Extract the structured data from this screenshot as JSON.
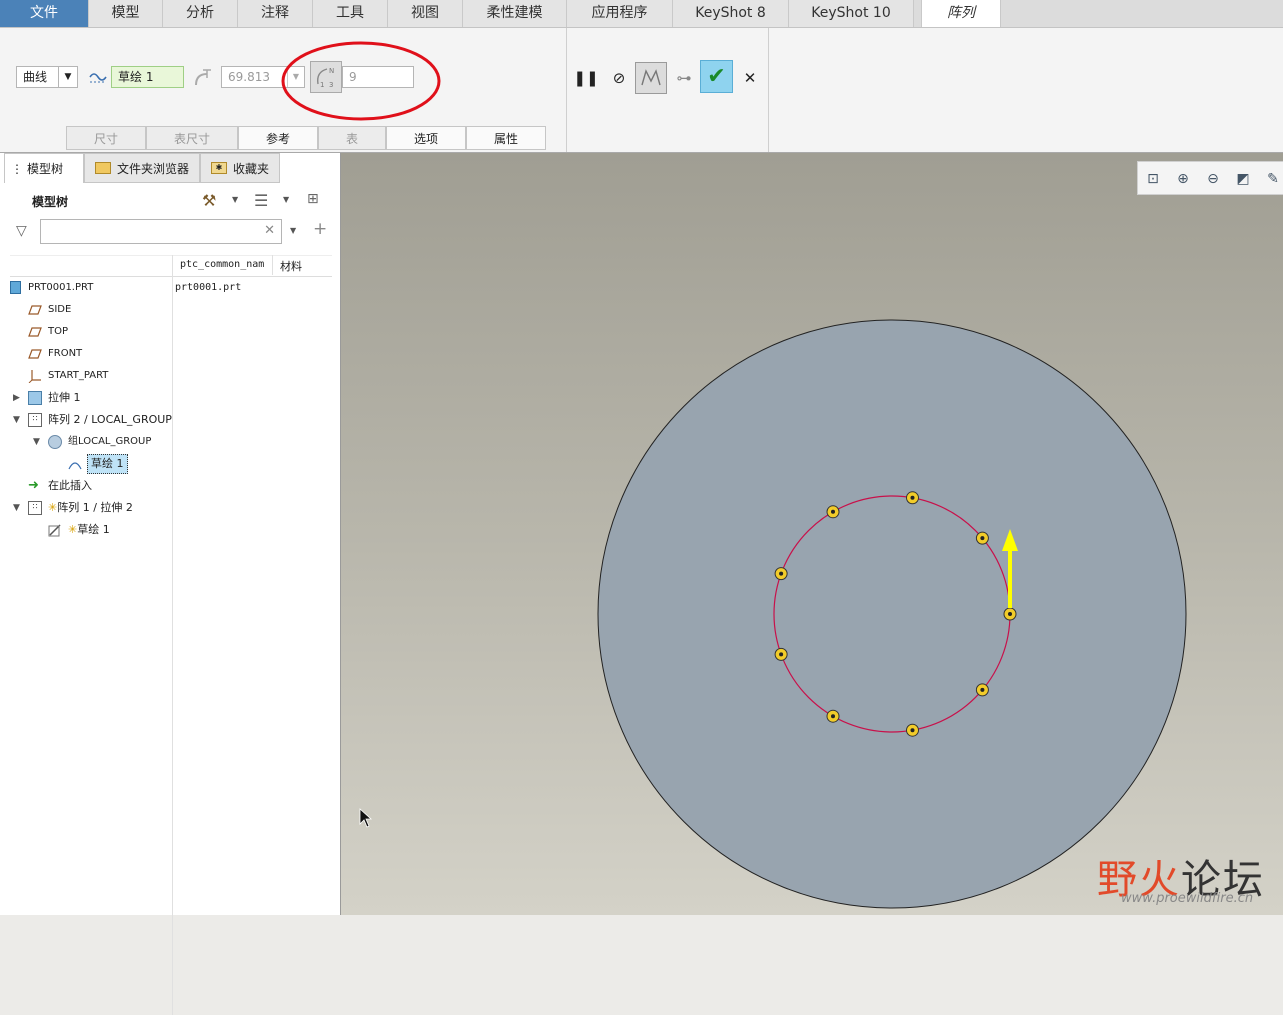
{
  "menubar": {
    "tabs": [
      "文件",
      "模型",
      "分析",
      "注释",
      "工具",
      "视图",
      "柔性建模",
      "应用程序",
      "KeyShot 8",
      "KeyShot 10",
      "阵列"
    ]
  },
  "ribbon": {
    "type_select": "曲线",
    "sketch_ref": "草绘 1",
    "spacing_value": "69.813",
    "count_value": "9",
    "subtabs": [
      "尺寸",
      "表尺寸",
      "参考",
      "表",
      "选项",
      "属性"
    ]
  },
  "panel": {
    "tabs": [
      "模型树",
      "文件夹浏览器",
      "收藏夹"
    ],
    "title": "模型树",
    "search_placeholder": "",
    "columns": [
      "ptc_common_nam",
      "材料"
    ],
    "tree": [
      {
        "label": "PRT0001.PRT",
        "value": "prt0001.prt"
      },
      {
        "label": "SIDE"
      },
      {
        "label": "TOP"
      },
      {
        "label": "FRONT"
      },
      {
        "label": "START_PART"
      },
      {
        "label": "拉伸 1"
      },
      {
        "label": "阵列 2 / LOCAL_GROUP"
      },
      {
        "label": "组LOCAL_GROUP"
      },
      {
        "label": "草绘 1"
      },
      {
        "label": "在此插入"
      },
      {
        "label": "阵列 1 / 拉伸 2"
      },
      {
        "label": "草绘 1"
      }
    ]
  },
  "watermark": {
    "title": "野火论坛",
    "url": "www.proewildfire.cn"
  },
  "colors": {
    "accent": "#4b82b8",
    "disk": "#98a4af",
    "pattern_circle": "#c8104a",
    "arrow": "#ffff00",
    "annotation_circle": "#e0101a"
  }
}
